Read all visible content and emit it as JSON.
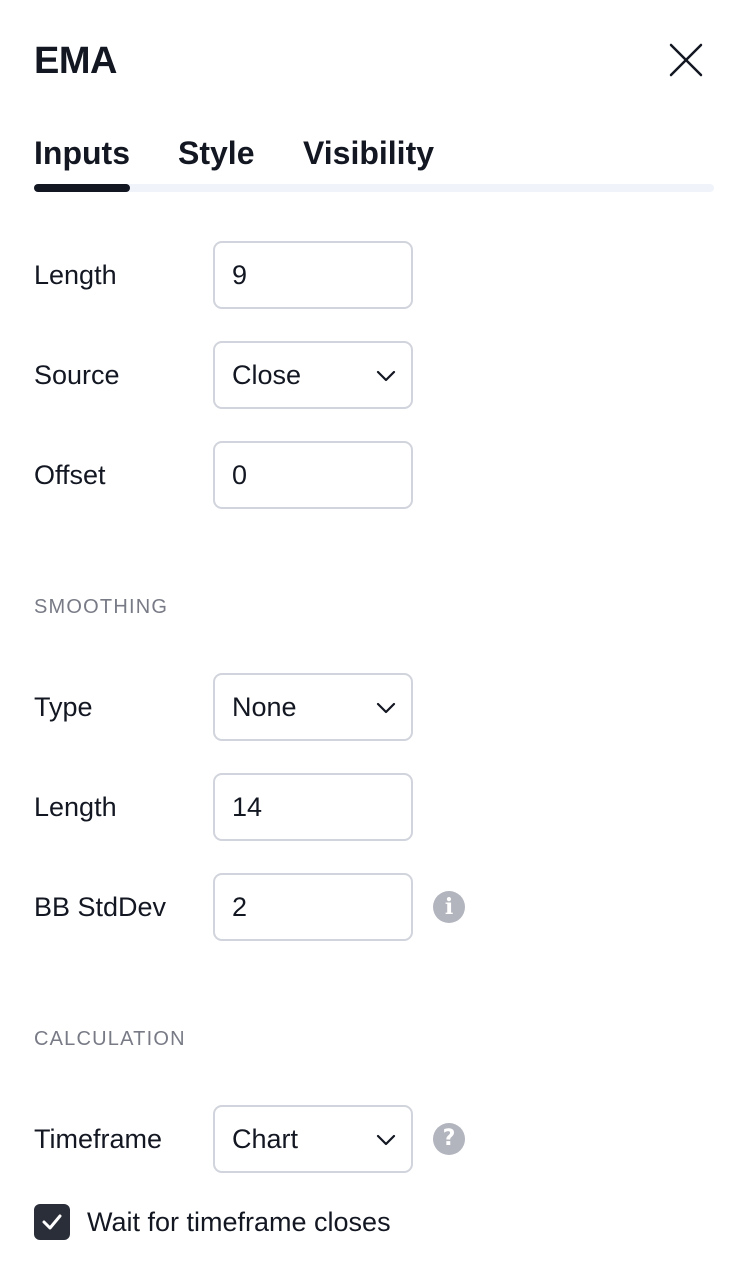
{
  "dialog": {
    "title": "EMA",
    "close_icon": "close-icon"
  },
  "tabs": [
    {
      "label": "Inputs",
      "active": true
    },
    {
      "label": "Style",
      "active": false
    },
    {
      "label": "Visibility",
      "active": false
    }
  ],
  "inputs": {
    "length": {
      "label": "Length",
      "value": "9"
    },
    "source": {
      "label": "Source",
      "value": "Close"
    },
    "offset": {
      "label": "Offset",
      "value": "0"
    }
  },
  "smoothing": {
    "section_title": "SMOOTHING",
    "type": {
      "label": "Type",
      "value": "None"
    },
    "length": {
      "label": "Length",
      "value": "14"
    },
    "bb_stddev": {
      "label": "BB StdDev",
      "value": "2",
      "info_icon": "info-icon"
    }
  },
  "calculation": {
    "section_title": "CALCULATION",
    "timeframe": {
      "label": "Timeframe",
      "value": "Chart",
      "help_icon": "help-icon"
    },
    "wait_checkbox": {
      "label": "Wait for timeframe closes",
      "checked": true
    }
  },
  "colors": {
    "text": "#131722",
    "muted": "#787b86",
    "border": "#d1d4dc",
    "icon_gray": "#b2b5be",
    "checkbox_fill": "#2a2e39"
  }
}
